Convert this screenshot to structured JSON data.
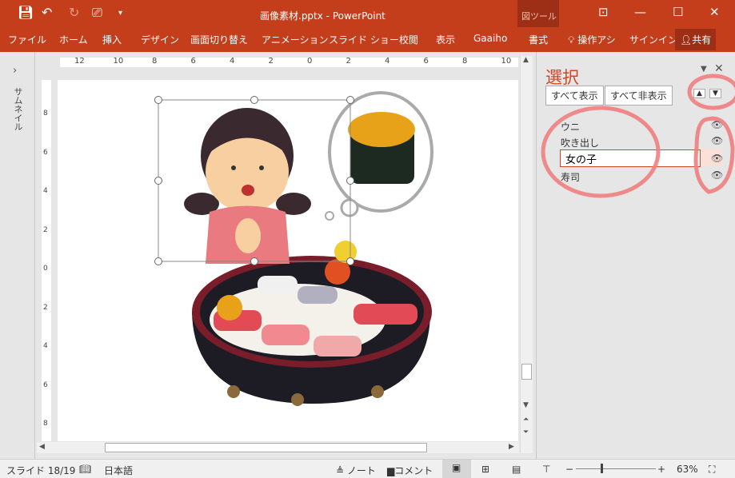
{
  "title_bar": {
    "title": "画像素材.pptx - PowerPoint",
    "context_tab_group": "図ツール"
  },
  "quick_access": {
    "save": "save-icon",
    "undo": "undo-icon",
    "redo": "redo-icon",
    "present": "present-icon",
    "customize": "▾"
  },
  "ribbon_tabs": [
    "ファイル",
    "ホーム",
    "挿入",
    "デザイン",
    "画面切り替え",
    "アニメーション",
    "スライド ショー",
    "校閲",
    "表示",
    "Gaaiho",
    "書式"
  ],
  "tell_me": "操作アシ",
  "sign_in": "サインイン",
  "share": "共有",
  "thumbnail_pane": {
    "label": "サムネイル",
    "expand": "›"
  },
  "ruler": {
    "labels": [
      "12",
      "10",
      "8",
      "6",
      "4",
      "2",
      "0",
      "2",
      "4",
      "6",
      "8",
      "10"
    ]
  },
  "vruler": {
    "labels": [
      "8",
      "6",
      "4",
      "2",
      "0",
      "2",
      "4",
      "6",
      "8"
    ]
  },
  "selection_pane": {
    "title": "選択",
    "show_all": "すべて表示",
    "hide_all": "すべて非表示",
    "items": [
      {
        "name": "ウニ",
        "visible": true
      },
      {
        "name": "吹き出し",
        "visible": true
      },
      {
        "name": "女の子",
        "visible": true,
        "editing": true
      },
      {
        "name": "寿司",
        "visible": true
      }
    ]
  },
  "status": {
    "slide": "スライド 18/19",
    "language": "日本語",
    "notes": "ノート",
    "comments": "コメント",
    "zoom": "63%",
    "zoom_value": 63
  },
  "colors": {
    "accent": "#c43e1c",
    "annotation": "#f08080"
  }
}
